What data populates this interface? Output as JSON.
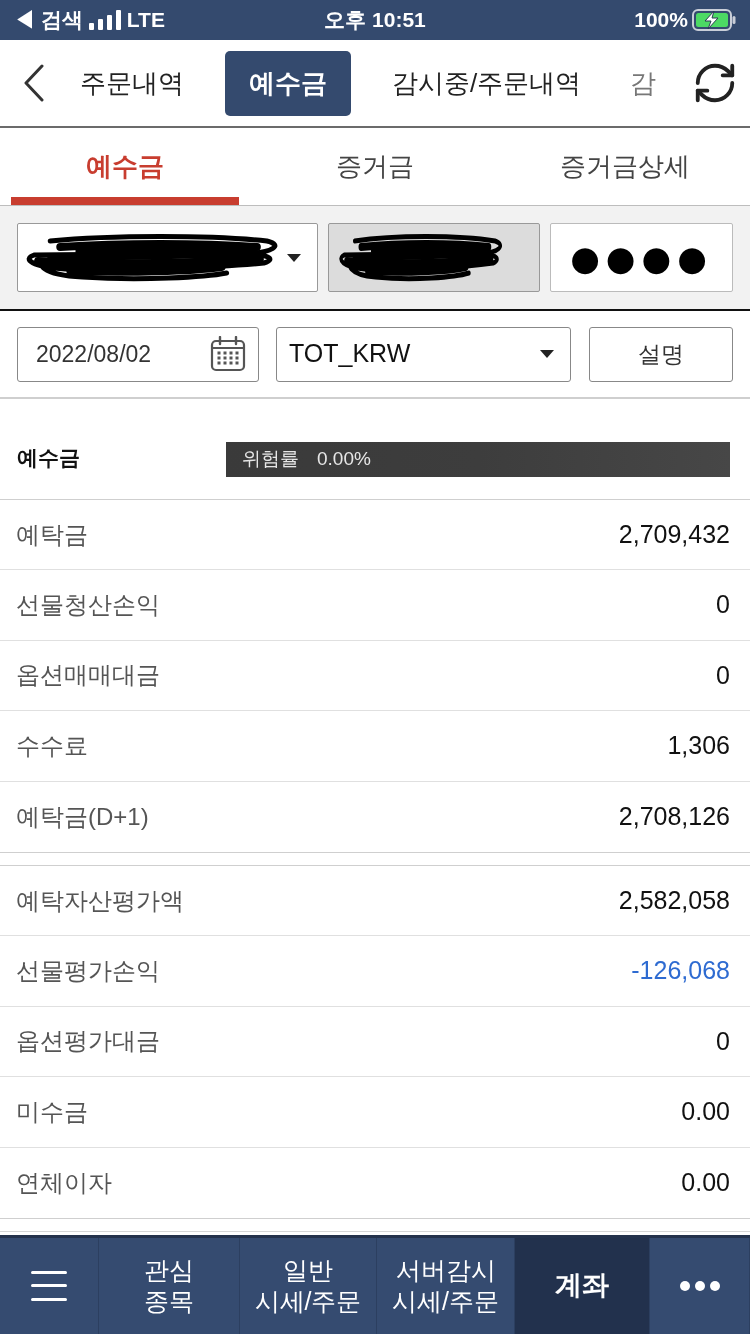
{
  "status_bar": {
    "back_label": "◀ 검색",
    "network": "LTE",
    "time": "오후 10:51",
    "battery": "100%",
    "charging": true
  },
  "top_tabs": [
    {
      "label": "주문내역",
      "selected": false
    },
    {
      "label": "예수금",
      "selected": true
    },
    {
      "label": "감시중/주문내역",
      "selected": false
    },
    {
      "label": "감",
      "selected": false
    }
  ],
  "sub_tabs": [
    {
      "label": "예수금",
      "selected": true
    },
    {
      "label": "증거금",
      "selected": false
    },
    {
      "label": "증거금상세",
      "selected": false
    }
  ],
  "account": {
    "account_select": {
      "masked": true
    },
    "account_name": {
      "masked": true
    },
    "password": {
      "value": "●●●●"
    }
  },
  "filters": {
    "date": "2022/08/02",
    "currency": "TOT_KRW",
    "help_button": "설명"
  },
  "summary": {
    "title": "예수금",
    "risk_label": "위험률",
    "risk_value": "0.00%"
  },
  "groups": [
    {
      "rows": [
        {
          "label": "예탁금",
          "value": "2,709,432",
          "color": "#111111"
        },
        {
          "label": "선물청산손익",
          "value": "0",
          "color": "#111111"
        },
        {
          "label": "옵션매매대금",
          "value": "0",
          "color": "#111111"
        },
        {
          "label": "수수료",
          "value": "1,306",
          "color": "#111111"
        },
        {
          "label": "예탁금(D+1)",
          "value": "2,708,126",
          "color": "#111111"
        }
      ]
    },
    {
      "rows": [
        {
          "label": "예탁자산평가액",
          "value": "2,582,058",
          "color": "#111111"
        },
        {
          "label": "선물평가손익",
          "value": "-126,068",
          "color": "#2e6bd1"
        },
        {
          "label": "옵션평가대금",
          "value": "0",
          "color": "#111111"
        },
        {
          "label": "미수금",
          "value": "0.00",
          "color": "#111111"
        },
        {
          "label": "연체이자",
          "value": "0.00",
          "color": "#111111"
        }
      ]
    }
  ],
  "bottom_nav": [
    {
      "kind": "menu",
      "selected": false
    },
    {
      "kind": "tab",
      "lines": [
        "관심",
        "종목"
      ],
      "selected": false
    },
    {
      "kind": "tab",
      "lines": [
        "일반",
        "시세/주문"
      ],
      "selected": false
    },
    {
      "kind": "tab",
      "lines": [
        "서버감시",
        "시세/주문"
      ],
      "selected": false
    },
    {
      "kind": "tab",
      "lines": [
        "계좌"
      ],
      "selected": true
    },
    {
      "kind": "more",
      "selected": false
    }
  ]
}
